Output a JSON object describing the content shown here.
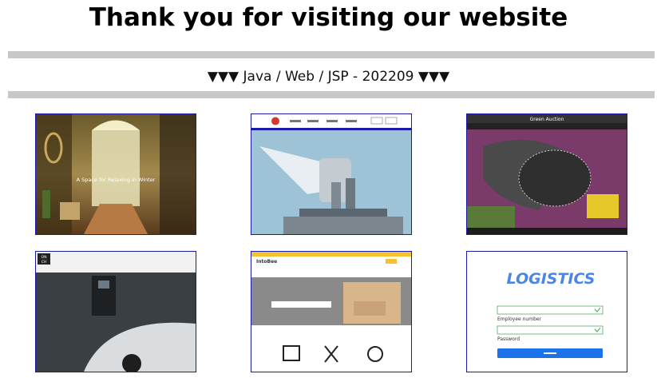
{
  "page": {
    "title": "Thank you for visiting our website",
    "subtitle": "▼▼▼ Java / Web / JSP - 202209 ▼▼▼"
  },
  "projects": [
    {
      "id": 1,
      "icon": "hotel-hallway-preview",
      "caption": "A Space for Relaxing in Winter"
    },
    {
      "id": 2,
      "icon": "microscope-preview"
    },
    {
      "id": 3,
      "icon": "green-auction-preview",
      "header": "Green Auction"
    },
    {
      "id": 4,
      "icon": "ev-charging-preview",
      "logo_top": "ON",
      "logo_bottom": "CH"
    },
    {
      "id": 5,
      "icon": "interior-shop-preview",
      "brand": "IntoBee"
    },
    {
      "id": 6,
      "icon": "logistics-login-preview",
      "logo": "LOGISTICS",
      "id_label": "Employee number",
      "pw_label": "Password"
    }
  ],
  "colors": {
    "rule": "#c8c8c8",
    "thumb_border": "#1a1aa8",
    "logistics_blue": "#4a86e8",
    "login_button": "#1a73e8"
  }
}
